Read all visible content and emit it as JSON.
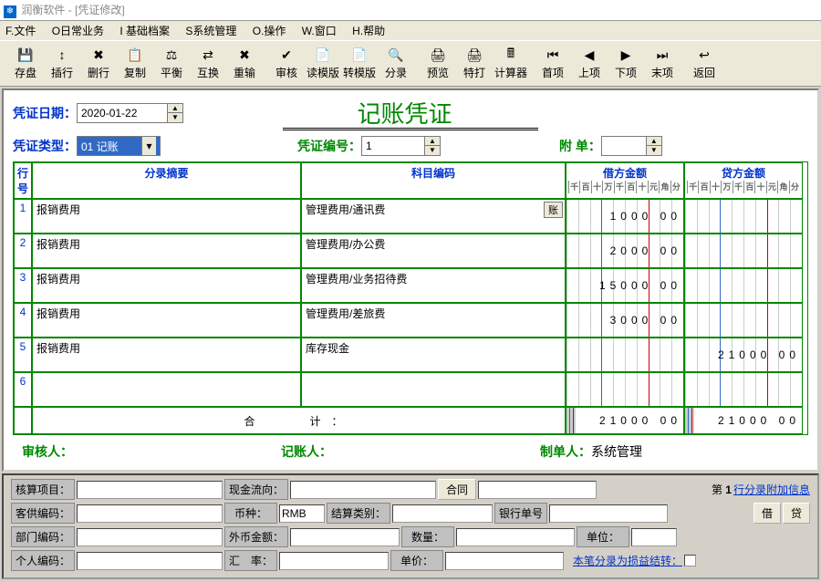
{
  "window": {
    "title": "润衡软件 - [凭证修改]"
  },
  "menu": [
    "F.文件",
    "O日常业务",
    "I 基础档案",
    "S系统管理",
    "O.操作",
    "W.窗口",
    "H.帮助"
  ],
  "toolbar": [
    {
      "label": "存盘",
      "icon": "💾"
    },
    {
      "label": "插行",
      "icon": "↕"
    },
    {
      "label": "删行",
      "icon": "✖"
    },
    {
      "label": "复制",
      "icon": "📋"
    },
    {
      "label": "平衡",
      "icon": "⚖"
    },
    {
      "label": "互换",
      "icon": "⇄"
    },
    {
      "label": "重输",
      "icon": "✖"
    },
    {
      "label": "审核",
      "icon": "✔"
    },
    {
      "label": "读模版",
      "icon": "📄"
    },
    {
      "label": "转模版",
      "icon": "📄"
    },
    {
      "label": "分录",
      "icon": "🔍"
    },
    {
      "label": "预览",
      "icon": "🖨"
    },
    {
      "label": "特打",
      "icon": "🖨"
    },
    {
      "label": "计算器",
      "icon": "🖩"
    },
    {
      "label": "首项",
      "icon": "⏮"
    },
    {
      "label": "上项",
      "icon": "◀"
    },
    {
      "label": "下项",
      "icon": "▶"
    },
    {
      "label": "末项",
      "icon": "⏭"
    },
    {
      "label": "返回",
      "icon": "↩"
    }
  ],
  "header": {
    "date_label": "凭证日期：",
    "date_value": "2020-01-22",
    "type_label": "凭证类型：",
    "type_value": "01 记账",
    "title": "记账凭证",
    "number_label": "凭证编号：",
    "number_value": "1",
    "attach_label": "附 单：",
    "attach_value": ""
  },
  "grid": {
    "col_rownum": "行号",
    "col_summary": "分录摘要",
    "col_subject": "科目编码",
    "col_debit": "借方金额",
    "col_credit": "贷方金额",
    "btn_account": "账",
    "rows": [
      {
        "n": "1",
        "summary": "报销费用",
        "subject": "管理费用/通讯费",
        "debit": "1000 00",
        "credit": ""
      },
      {
        "n": "2",
        "summary": "报销费用",
        "subject": "管理费用/办公费",
        "debit": "2000 00",
        "credit": ""
      },
      {
        "n": "3",
        "summary": "报销费用",
        "subject": "管理费用/业务招待费",
        "debit": "15000 00",
        "credit": ""
      },
      {
        "n": "4",
        "summary": "报销费用",
        "subject": "管理费用/差旅费",
        "debit": "3000 00",
        "credit": ""
      },
      {
        "n": "5",
        "summary": "报销费用",
        "subject": "库存现金",
        "debit": "",
        "credit": "21000 00"
      },
      {
        "n": "6",
        "summary": "",
        "subject": "",
        "debit": "",
        "credit": ""
      }
    ],
    "total_label": "合　　计：",
    "total_debit": "21000 00",
    "total_credit": "21000 00"
  },
  "footer": {
    "auditor": "审核人：",
    "keeper": "记账人：",
    "maker": "制单人：",
    "maker_val": "系统管理"
  },
  "bottom": {
    "proj": "核算项目：",
    "cashflow": "现金流向：",
    "contract": "合同",
    "page_prefix": "第",
    "page_num": "1",
    "extra_link": "行分录附加信息",
    "vendor": "客供编码：",
    "currency": "币种：",
    "currency_val": "RMB",
    "settle": "结算类别：",
    "bankno": "银行单号",
    "btn_debit": "借",
    "btn_credit": "贷",
    "dept": "部门编码：",
    "foreign": "外币金额：",
    "qty": "数量：",
    "unit": "单位：",
    "person": "个人编码：",
    "rate": "汇　率：",
    "price": "单价：",
    "profit": "本笔分录为损益结转："
  }
}
